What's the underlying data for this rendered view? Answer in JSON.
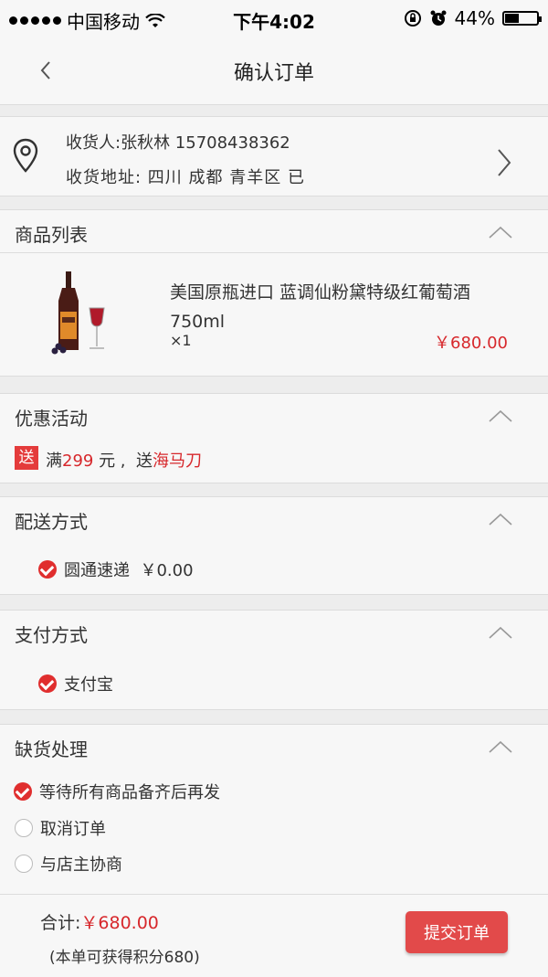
{
  "status_bar": {
    "carrier": "中国移动",
    "time": "下午4:02",
    "battery": "44%",
    "battery_level": 0.44
  },
  "nav": {
    "title": "确认订单"
  },
  "address": {
    "recipient": "收货人:张秋林 15708438362",
    "address": "收货地址:  四川 成都 青羊区 已"
  },
  "products_section": {
    "title": "商品列表",
    "items": [
      {
        "name": "美国原瓶进口 蓝调仙粉黛特级红葡萄酒 750ml",
        "qty": "×1",
        "price": "￥680.00"
      }
    ]
  },
  "promo_section": {
    "title": "优惠活动",
    "tag": "送",
    "text_prefix": "满",
    "threshold": "299",
    "text_mid": " 元 ,  送",
    "gift": "海马刀"
  },
  "shipping_section": {
    "title": "配送方式",
    "selected": "圆通速递  ￥0.00"
  },
  "payment_section": {
    "title": "支付方式",
    "selected": "支付宝"
  },
  "stockout_section": {
    "title": "缺货处理",
    "options": [
      {
        "label": "等待所有商品备齐后再发",
        "checked": true
      },
      {
        "label": "取消订单",
        "checked": false
      },
      {
        "label": "与店主协商",
        "checked": false
      }
    ]
  },
  "footer": {
    "total_label": "合计:",
    "total_value": "￥680.00",
    "points": "(本单可获得积分680)",
    "submit_label": "提交订单"
  },
  "colors": {
    "accent": "#d7282c",
    "button": "#e24a4a",
    "background": "#ededed",
    "card": "#f7f7f7"
  }
}
